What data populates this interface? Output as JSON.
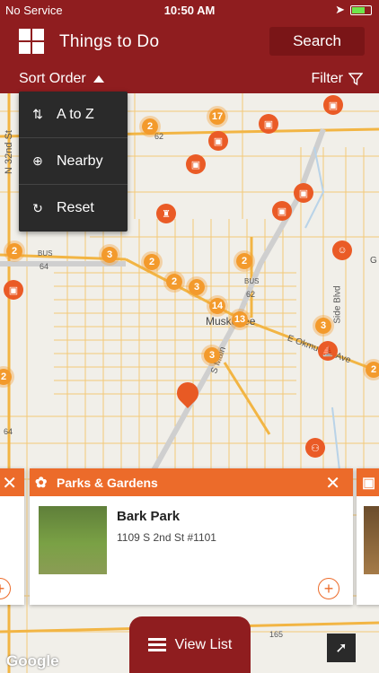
{
  "status_bar": {
    "carrier": "No Service",
    "time": "10:50 AM",
    "battery_level": 0.7
  },
  "header": {
    "title": "Things to Do",
    "search_label": "Search"
  },
  "subbar": {
    "sort_label": "Sort Order",
    "filter_label": "Filter"
  },
  "sort_menu": [
    {
      "label": "A to Z",
      "icon": "sort-az-icon"
    },
    {
      "label": "Nearby",
      "icon": "crosshair-icon"
    },
    {
      "label": "Reset",
      "icon": "refresh-icon"
    }
  ],
  "map_labels": {
    "street_n32": "N 32nd St",
    "city": "Muskogee",
    "e_okmulgee": "E Okmulgee Ave",
    "s_main": "S Main",
    "side_blvd": "Side Blvd",
    "route_62a": "62",
    "route_62b": "62",
    "route_64a": "64",
    "route_64b": "64",
    "route_165": "165",
    "bus_a": "BUS",
    "bus_b": "BUS",
    "edge_g": "G"
  },
  "cluster_counts": [
    "2",
    "17",
    "2",
    "3",
    "2",
    "2",
    "2",
    "3",
    "14",
    "13",
    "3",
    "3",
    "2",
    "2"
  ],
  "card": {
    "category": "Parks & Gardens",
    "name": "Bark Park",
    "address": "1109 S 2nd St #1101",
    "category_icon": "rose-icon"
  },
  "view_list_label": "View List",
  "attribution": "Google",
  "colors": {
    "brand": "#8f1d1f",
    "accent": "#ec6b2a",
    "marker": "#f39a2c"
  }
}
